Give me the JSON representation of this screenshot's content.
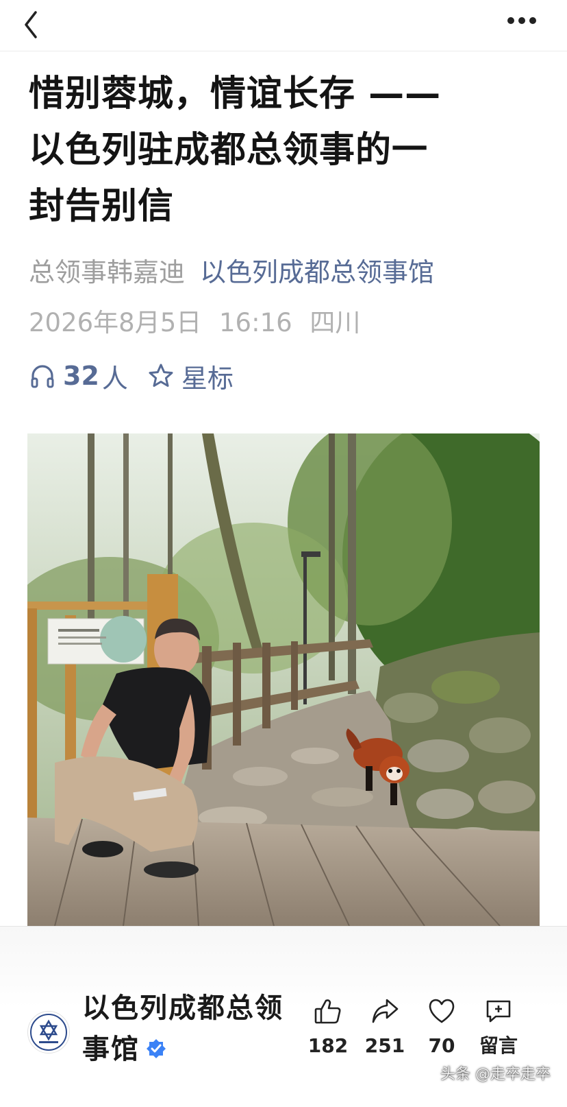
{
  "nav": {
    "back_icon": "chevron-left-icon",
    "more_icon": "more-horizontal-icon"
  },
  "article": {
    "title_lines": [
      "惜别蓉城，情谊长存 ——",
      "以色列驻成都总领事的一",
      "封告别信"
    ],
    "author": "总领事韩嘉迪",
    "account": "以色列成都总领事馆",
    "date": "2026年8月5日",
    "time": "16:16",
    "location": "四川",
    "listen_count": "32",
    "listen_unit": "人",
    "star_label": "星标"
  },
  "colors": {
    "link": "#576b95",
    "meta_gray": "#b1b1b1",
    "author_gray": "#9e9e9e",
    "verified_blue": "#3b82f6"
  },
  "bottom": {
    "account_name_line1": "以色列成都总领",
    "account_name_line2": "事馆",
    "actions": {
      "like": "182",
      "share": "251",
      "favorite": "70",
      "comment": "留言"
    }
  },
  "watermark": "头条 @走卒走卒"
}
